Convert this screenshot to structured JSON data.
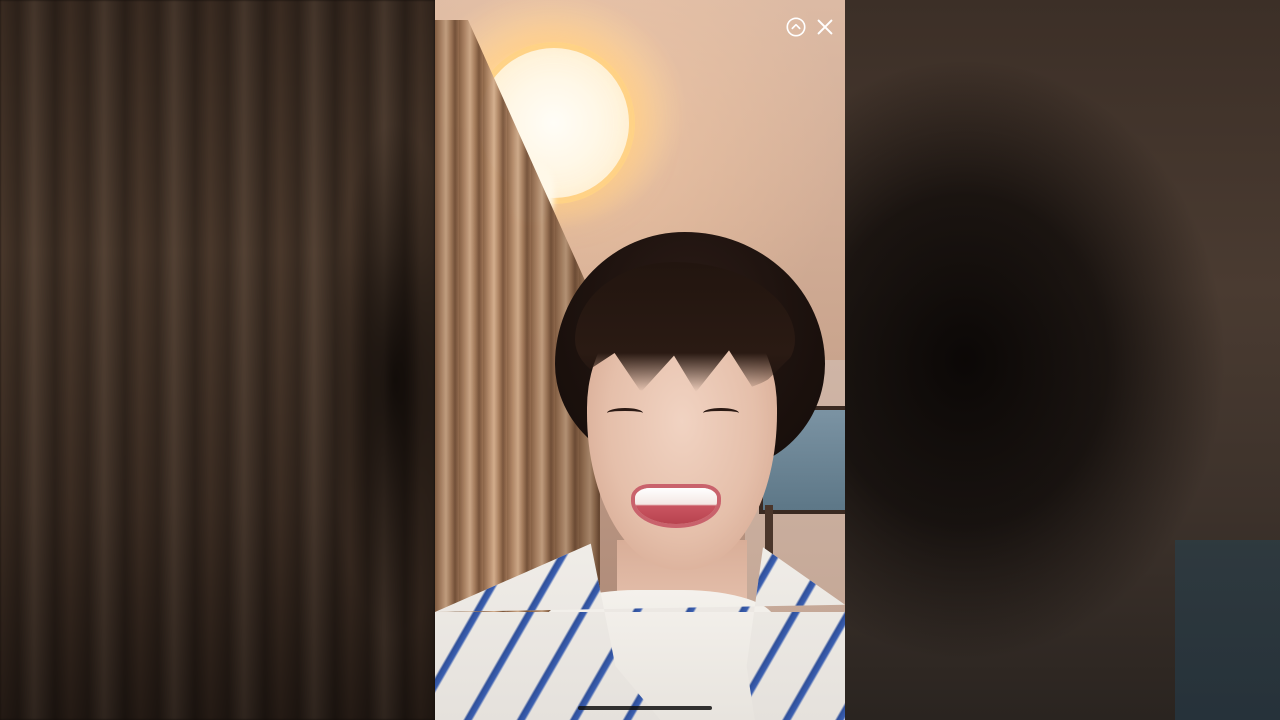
{
  "player": {
    "controls": {
      "expand_icon": "chevron-up-circle-icon",
      "close_icon": "close-x-icon"
    },
    "home_indicator": "home-bar"
  },
  "colors": {
    "control_icon": "#ffffff",
    "home_indicator": "#111111",
    "background": "#120d0a"
  }
}
